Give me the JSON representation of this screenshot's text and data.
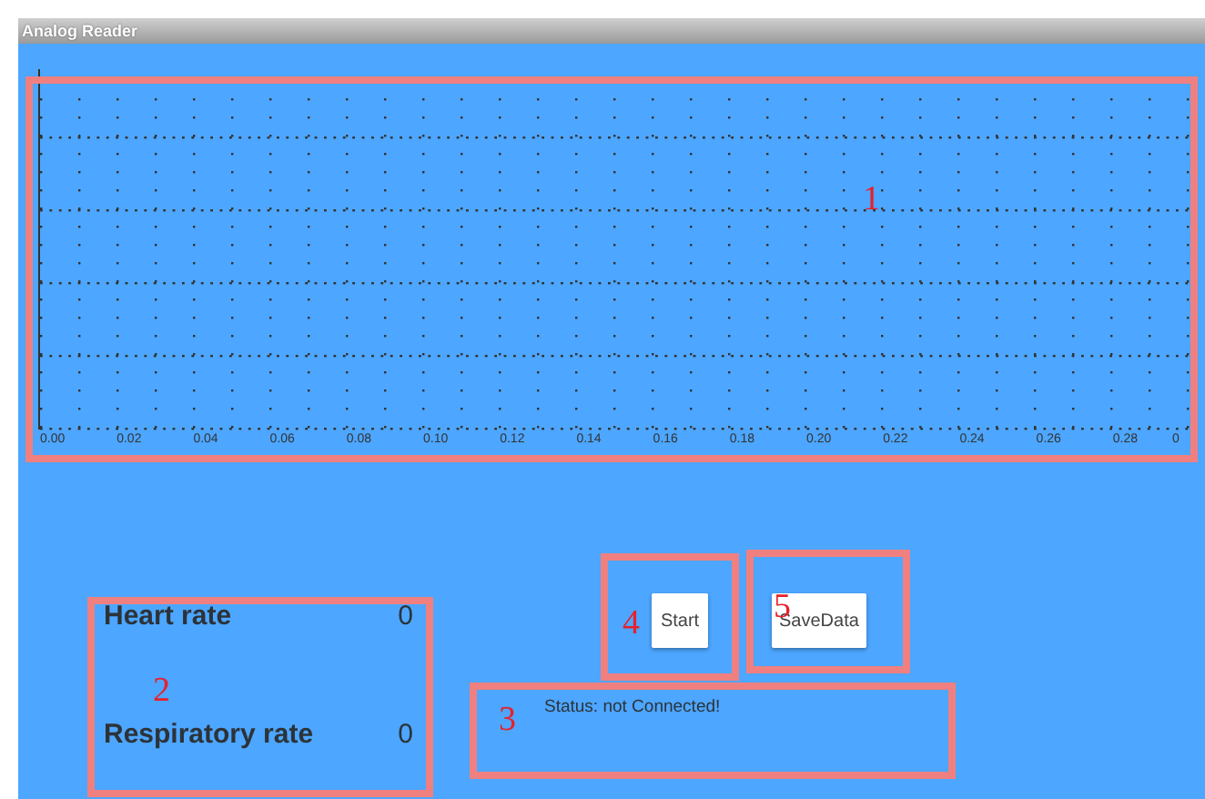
{
  "window": {
    "title": "Analog Reader"
  },
  "plot": {
    "x_tick_labels": [
      "0.00",
      "0.02",
      "0.04",
      "0.06",
      "0.08",
      "0.10",
      "0.12",
      "0.14",
      "0.16",
      "0.18",
      "0.20",
      "0.22",
      "0.24",
      "0.26",
      "0.28",
      "0"
    ]
  },
  "readings": [
    {
      "label": "Heart rate",
      "value": "0"
    },
    {
      "label": "Respiratory rate",
      "value": "0"
    }
  ],
  "buttons": [
    {
      "label": "Start"
    },
    {
      "label": "SaveData"
    }
  ],
  "status": "Status: not Connected!",
  "annotations": [
    {
      "number": "1"
    },
    {
      "number": "2"
    },
    {
      "number": "3"
    },
    {
      "number": "4"
    },
    {
      "number": "5"
    }
  ]
}
